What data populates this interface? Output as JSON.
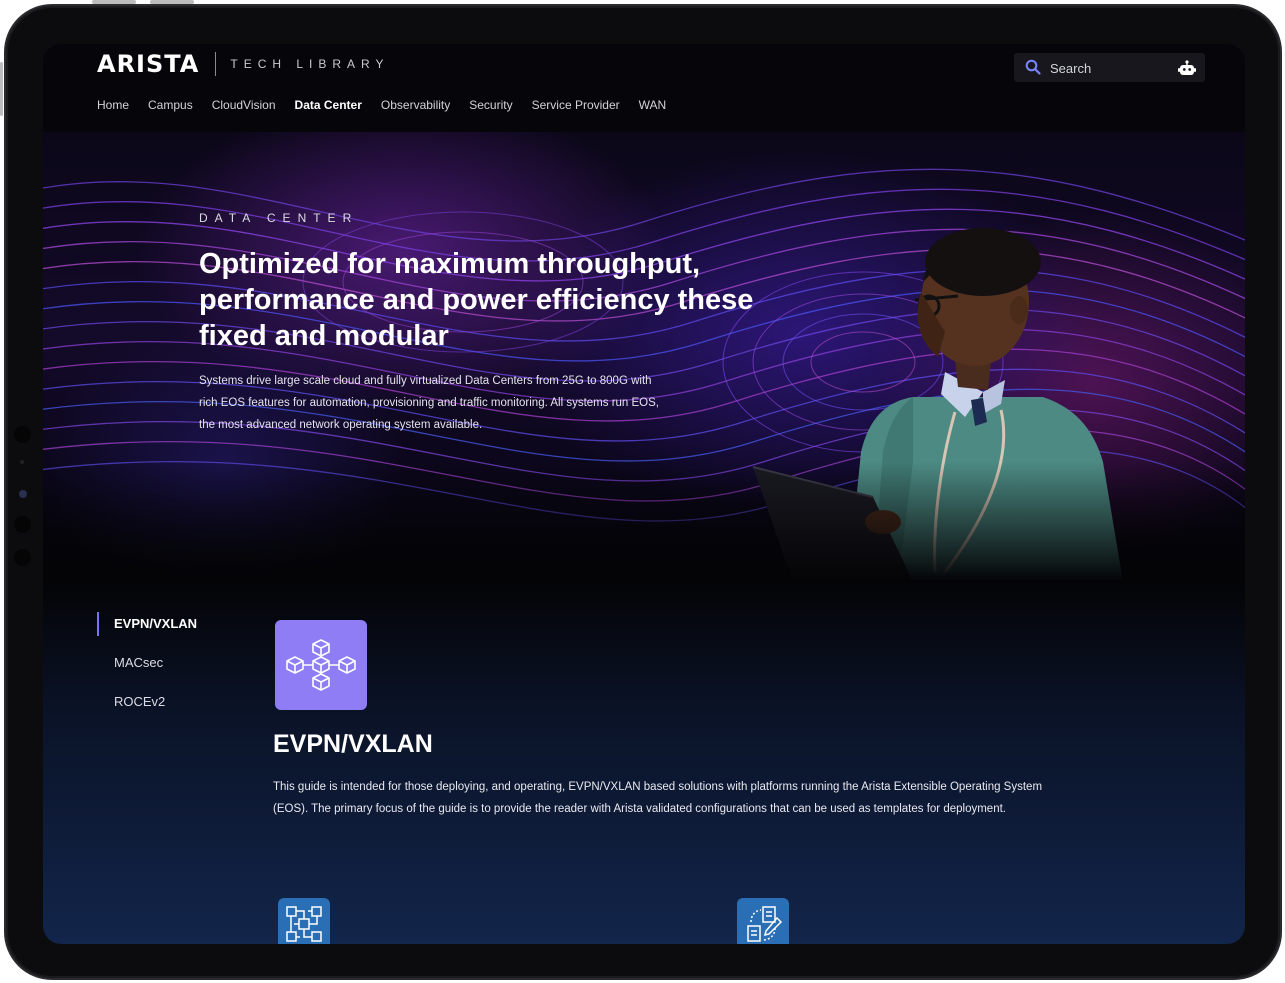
{
  "header": {
    "logo": "ARISTA",
    "logo_sub": "TECH LIBRARY",
    "search": {
      "placeholder": "Search"
    }
  },
  "nav": {
    "items": [
      {
        "label": "Home"
      },
      {
        "label": "Campus"
      },
      {
        "label": "CloudVision"
      },
      {
        "label": "Data Center",
        "active": true
      },
      {
        "label": "Observability"
      },
      {
        "label": "Security"
      },
      {
        "label": "Service Provider"
      },
      {
        "label": "WAN"
      }
    ]
  },
  "hero": {
    "eyebrow": "DATA CENTER",
    "title": "Optimized for maximum throughput, performance and power efficiency these fixed and modular",
    "description": "Systems drive large scale cloud and fully virtualized Data Centers from 25G to 800G with rich EOS features for automation, provisioning and traffic monitoring. All systems run EOS, the most advanced network operating system available."
  },
  "side_nav": {
    "items": [
      {
        "label": "EVPN/VXLAN",
        "active": true
      },
      {
        "label": "MACsec"
      },
      {
        "label": "ROCEv2"
      }
    ]
  },
  "section": {
    "title": "EVPN/VXLAN",
    "description": "This guide is intended for those deploying, and operating, EVPN/VXLAN based solutions with platforms running the Arista Extensible Operating System (EOS). The primary focus of the guide is to provide the reader with Arista validated configurations that can be used as templates for deployment."
  },
  "icons": {
    "search": "search-icon",
    "assistant": "robot-icon",
    "feature": "network-cubes-icon",
    "card_1": "circuit-diagram-icon",
    "card_2": "documents-edit-icon"
  },
  "colors": {
    "accent": "#7c70ff",
    "tile": "#8f7df5",
    "card_icon": "#2a6fb5",
    "search_icon": "#7a86ff"
  }
}
